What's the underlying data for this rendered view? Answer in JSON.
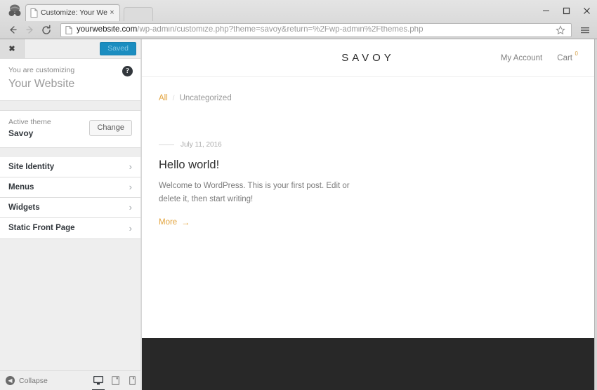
{
  "browser": {
    "tab": {
      "title": "Customize: Your Website -",
      "close_label": "×"
    },
    "window": {
      "minimize": "−",
      "maximize": "□",
      "close": "×"
    },
    "nav": {
      "back": "←",
      "forward": "→",
      "reload": "⟳"
    },
    "omnibox": {
      "domain": "yourwebsite.com",
      "path": "/wp-admin/customize.php?theme=savoy&return=%2Fwp-admin%2Fthemes.php",
      "full_url": "yourwebsite.com/wp-admin/customize.php?theme=savoy&return=%2Fwp-admin%2Fthemes.php"
    }
  },
  "customizer": {
    "close_label": "✖",
    "save_button": "Saved",
    "customizing_label": "You are customizing",
    "site_title": "Your Website",
    "help_label": "?",
    "theme": {
      "label": "Active theme",
      "name": "Savoy",
      "change_button": "Change"
    },
    "sections": [
      {
        "label": "Site Identity",
        "chevron": "›"
      },
      {
        "label": "Menus",
        "chevron": "›"
      },
      {
        "label": "Widgets",
        "chevron": "›"
      },
      {
        "label": "Static Front Page",
        "chevron": "›"
      }
    ],
    "footer": {
      "collapse_label": "Collapse",
      "collapse_icon": "◀",
      "devices": [
        {
          "name": "desktop",
          "active": true
        },
        {
          "name": "tablet",
          "active": false
        },
        {
          "name": "mobile",
          "active": false
        }
      ]
    }
  },
  "preview": {
    "logo": "SAVOY",
    "nav": {
      "my_account": "My Account",
      "cart": "Cart",
      "cart_count": "0"
    },
    "breadcrumb": {
      "all": "All",
      "separator": "/",
      "category": "Uncategorized"
    },
    "post": {
      "date": "July 11, 2016",
      "title": "Hello world!",
      "excerpt": "Welcome to WordPress. This is your first post. Edit or delete it, then start writing!",
      "more_label": "More",
      "more_arrow": "→"
    }
  },
  "colors": {
    "accent_gold": "#e2a33c",
    "save_blue": "#1b8dc0",
    "footer_dark": "#282828",
    "sidebar_bg": "#eeeeee"
  }
}
